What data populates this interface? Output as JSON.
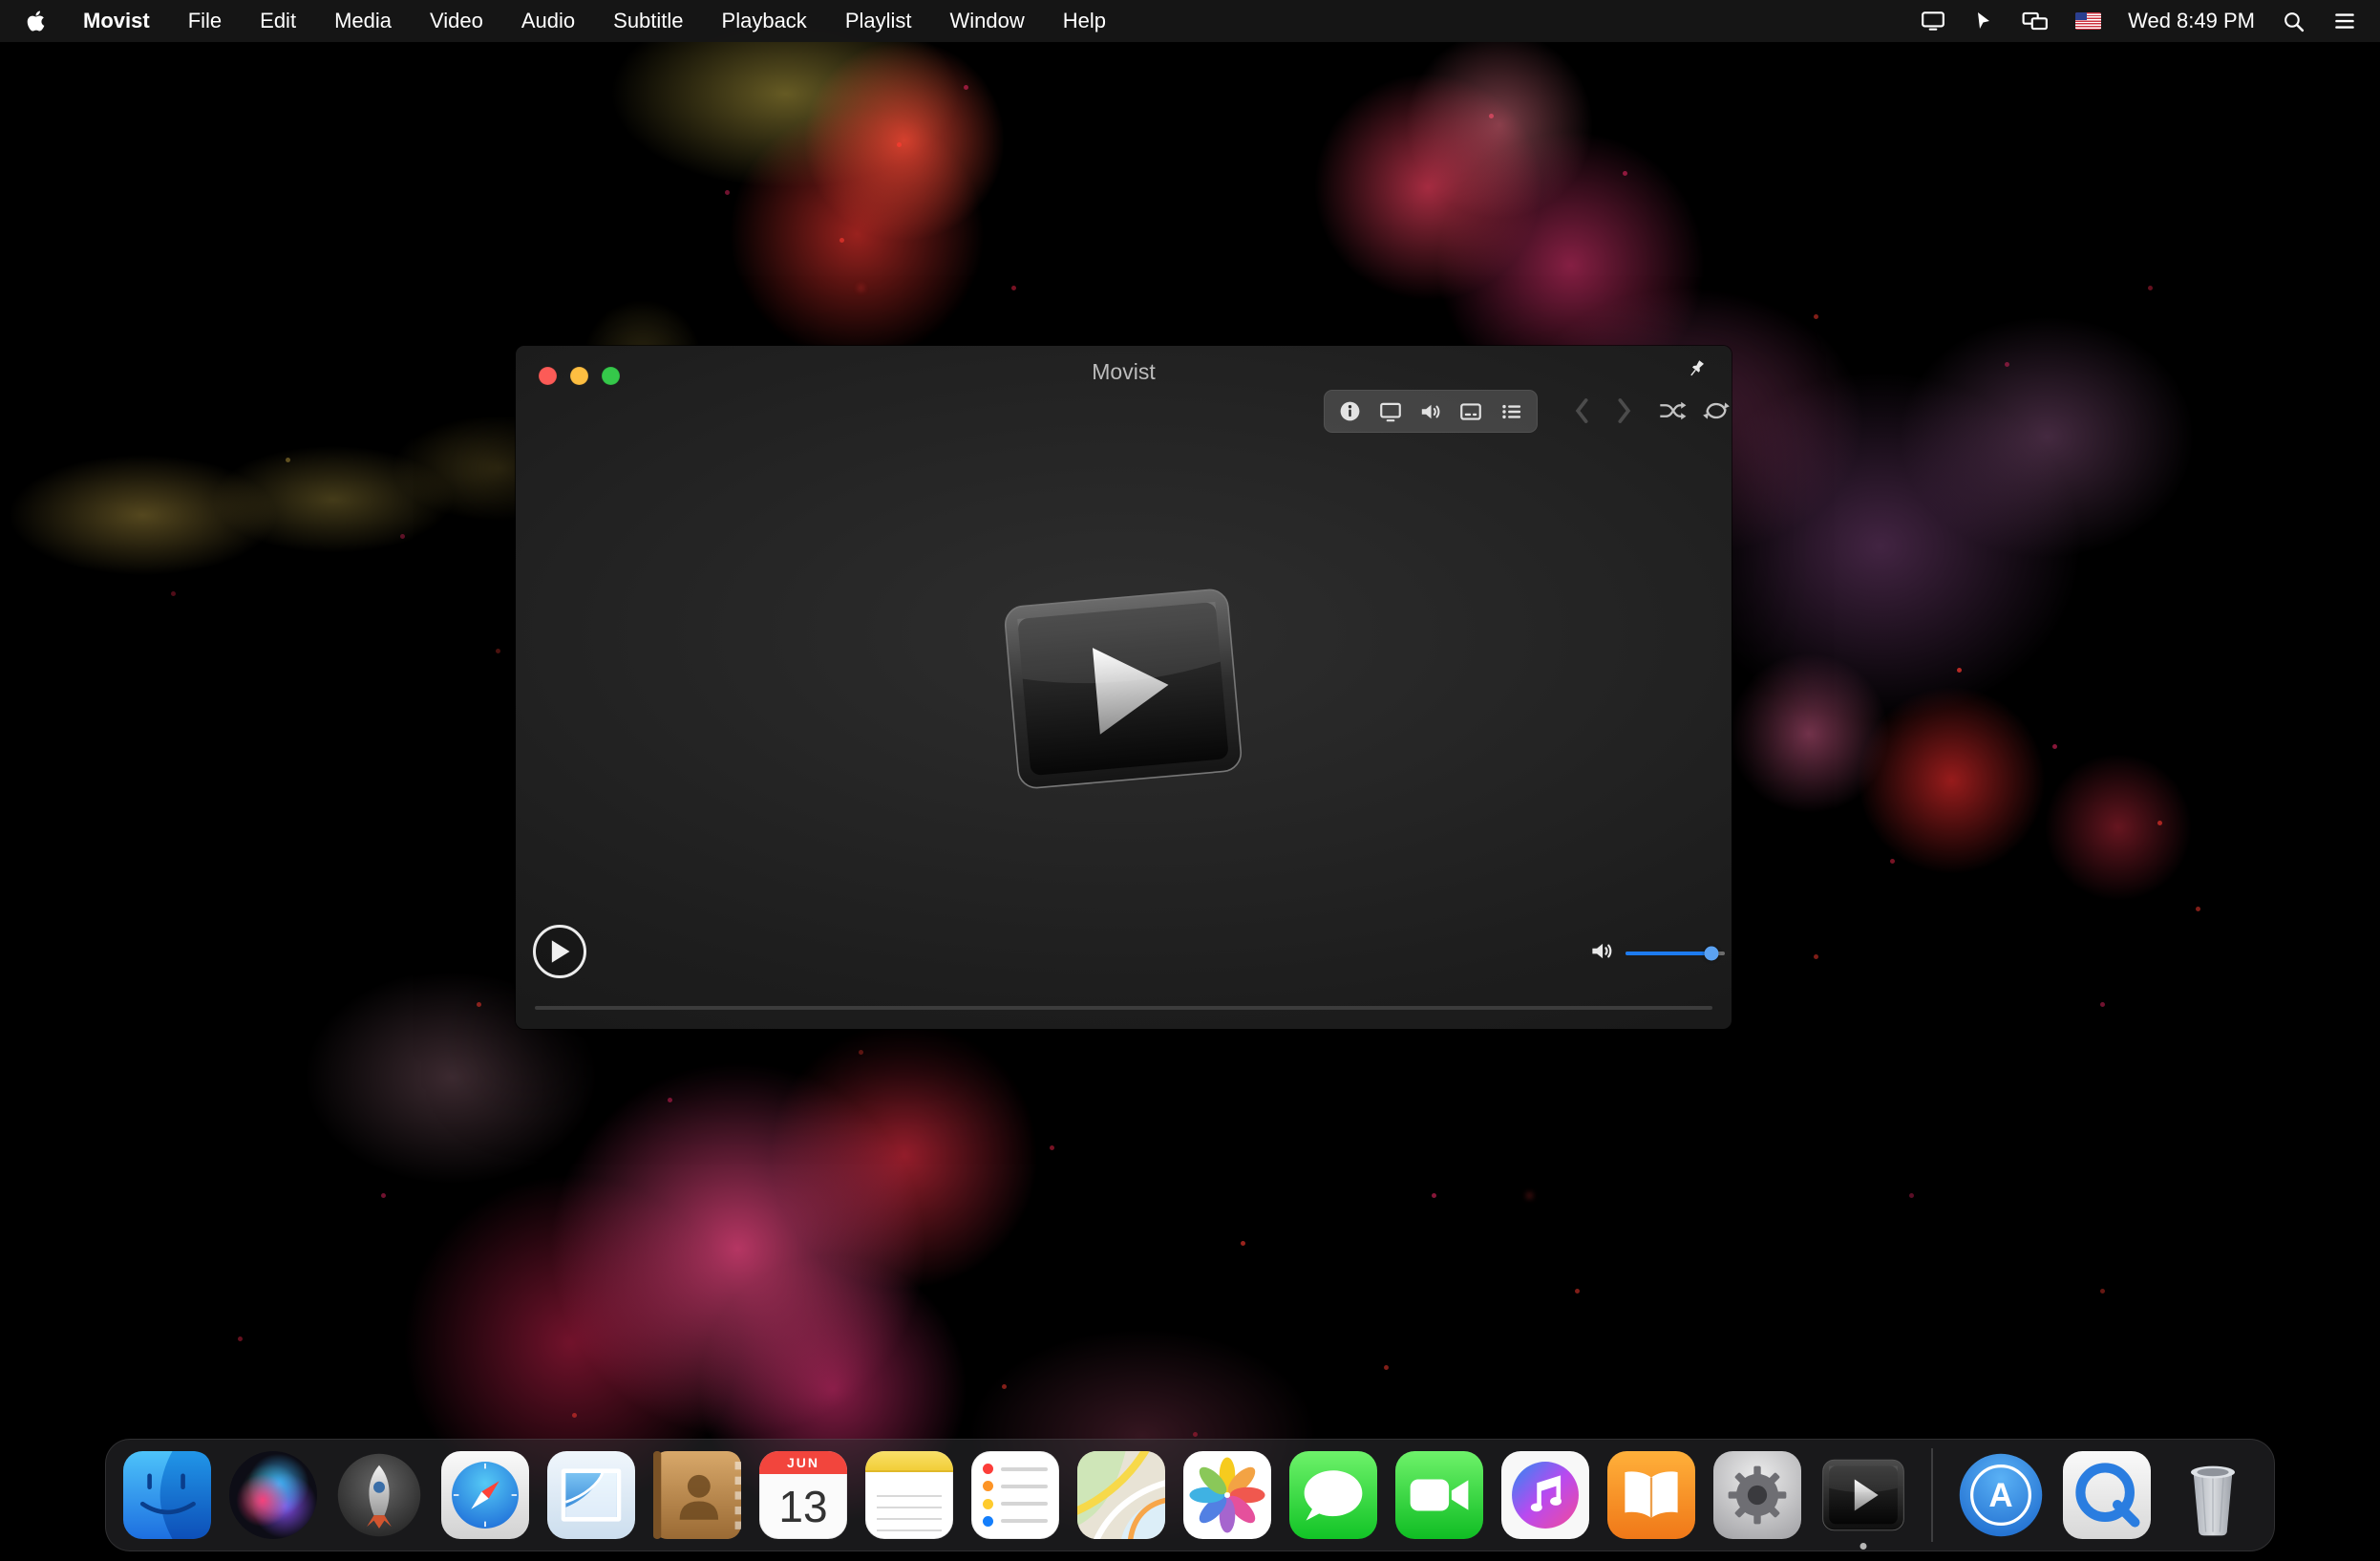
{
  "menu_bar": {
    "app_name": "Movist",
    "menus": [
      "File",
      "Edit",
      "Media",
      "Video",
      "Audio",
      "Subtitle",
      "Playback",
      "Playlist",
      "Window",
      "Help"
    ],
    "clock": "Wed 8:49 PM",
    "status_icons": [
      "display-icon",
      "pointer-icon",
      "mirroring-icon",
      "us-flag-icon",
      "spotlight-icon",
      "notification-center-icon"
    ]
  },
  "window": {
    "title": "Movist",
    "toolbar_icons": [
      "info-icon",
      "screen-icon",
      "speaker-icon",
      "subtitles-icon",
      "playlist-icon"
    ],
    "transport_icons": [
      "previous-icon",
      "next-icon",
      "shuffle-icon",
      "repeat-icon"
    ]
  },
  "player": {
    "volume_percent": 87,
    "progress_percent": 0
  },
  "dock": {
    "items": [
      "finder",
      "siri",
      "launchpad",
      "safari",
      "mail",
      "contacts",
      "calendar",
      "notes",
      "reminders",
      "maps",
      "photos",
      "messages",
      "facetime",
      "itunes",
      "ibooks",
      "system-preferences",
      "movist",
      "separator",
      "app-store",
      "quicktime",
      "trash"
    ],
    "running_app": "movist",
    "calendar_month": "JUN",
    "calendar_day": "13",
    "app_store_letter": "A"
  },
  "colors": {
    "menubar_bg": "#161616",
    "accent_blue": "#1d7bf0",
    "traffic_red": "#fc5b57",
    "traffic_yellow": "#fdbe41",
    "traffic_green": "#35c84a"
  }
}
